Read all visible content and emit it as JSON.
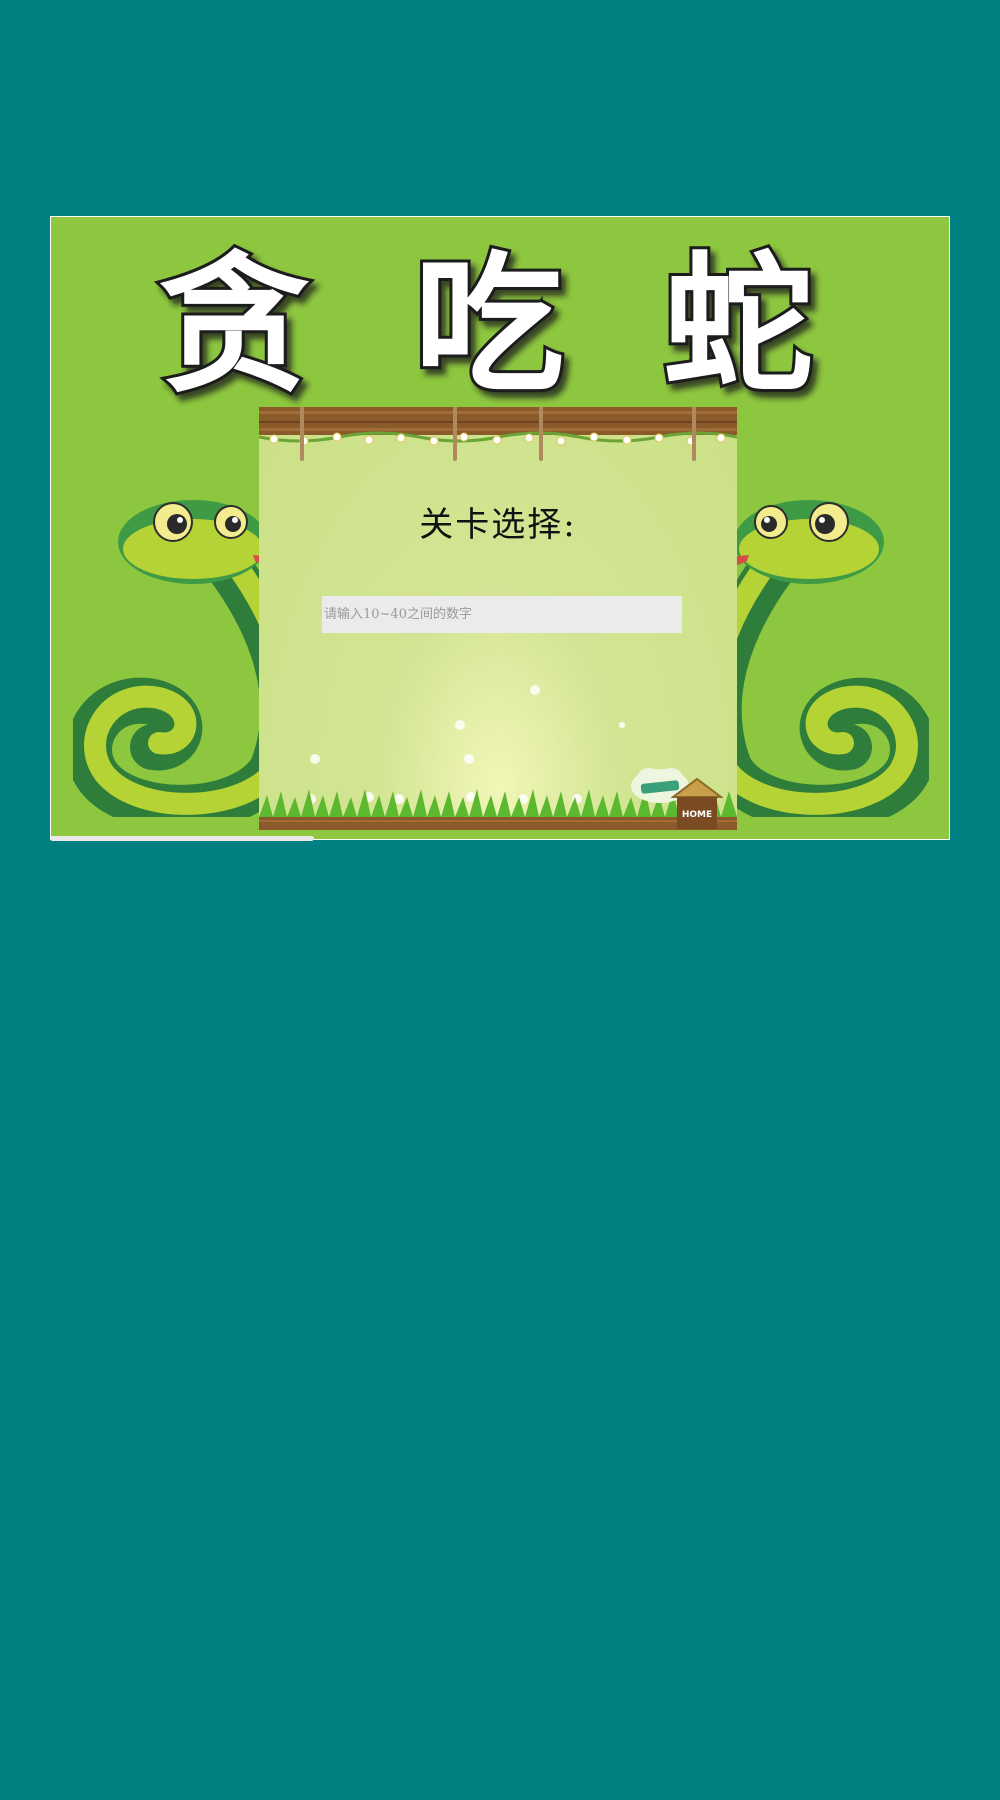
{
  "game": {
    "title_chars": [
      "贪",
      "吃",
      "蛇"
    ],
    "level_select_label": "关卡选择:",
    "level_input": {
      "value": "",
      "placeholder": "请输入10~40之间的数字"
    },
    "home_label": "HOME",
    "badge_text": ""
  },
  "colors": {
    "page_background": "#008080",
    "frame_green": "#8dc63f",
    "board_green": "#cbe086",
    "snake_dark": "#2e7d3a",
    "snake_light": "#b5d334"
  }
}
